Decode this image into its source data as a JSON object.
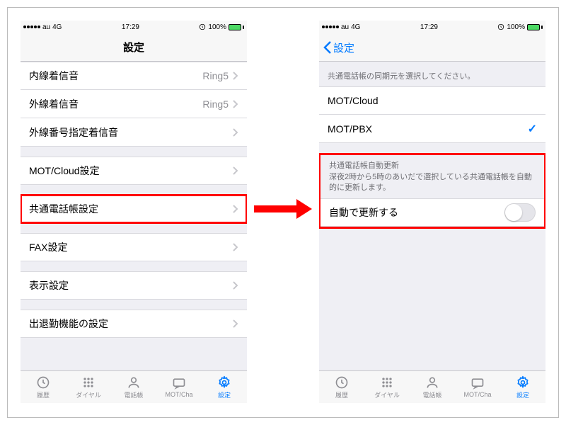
{
  "status": {
    "carrier": "au",
    "network": "4G",
    "time": "17:29",
    "battery": "100%"
  },
  "left": {
    "title": "設定",
    "rows": {
      "internal_ring": {
        "label": "内線着信音",
        "value": "Ring5"
      },
      "external_ring": {
        "label": "外線着信音",
        "value": "Ring5"
      },
      "ext_number_ring": {
        "label": "外線番号指定着信音"
      },
      "mot_cloud": {
        "label": "MOT/Cloud設定"
      },
      "shared_book": {
        "label": "共通電話帳設定"
      },
      "fax": {
        "label": "FAX設定"
      },
      "display": {
        "label": "表示設定"
      },
      "attendance": {
        "label": "出退勤機能の設定"
      }
    }
  },
  "right": {
    "back": "設定",
    "section1_label": "共通電話帳の同期元を選択してください。",
    "rows": {
      "mot_cloud": {
        "label": "MOT/Cloud"
      },
      "mot_pbx": {
        "label": "MOT/PBX"
      }
    },
    "section2_title": "共通電話帳自動更新",
    "section2_desc": "深夜2時から5時のあいだで選択している共通電話帳を自動的に更新します。",
    "auto_update": {
      "label": "自動で更新する"
    }
  },
  "tabs": {
    "history": "履歴",
    "dial": "ダイヤル",
    "contacts": "電話帳",
    "motcha": "MOT/Cha",
    "settings": "設定"
  }
}
